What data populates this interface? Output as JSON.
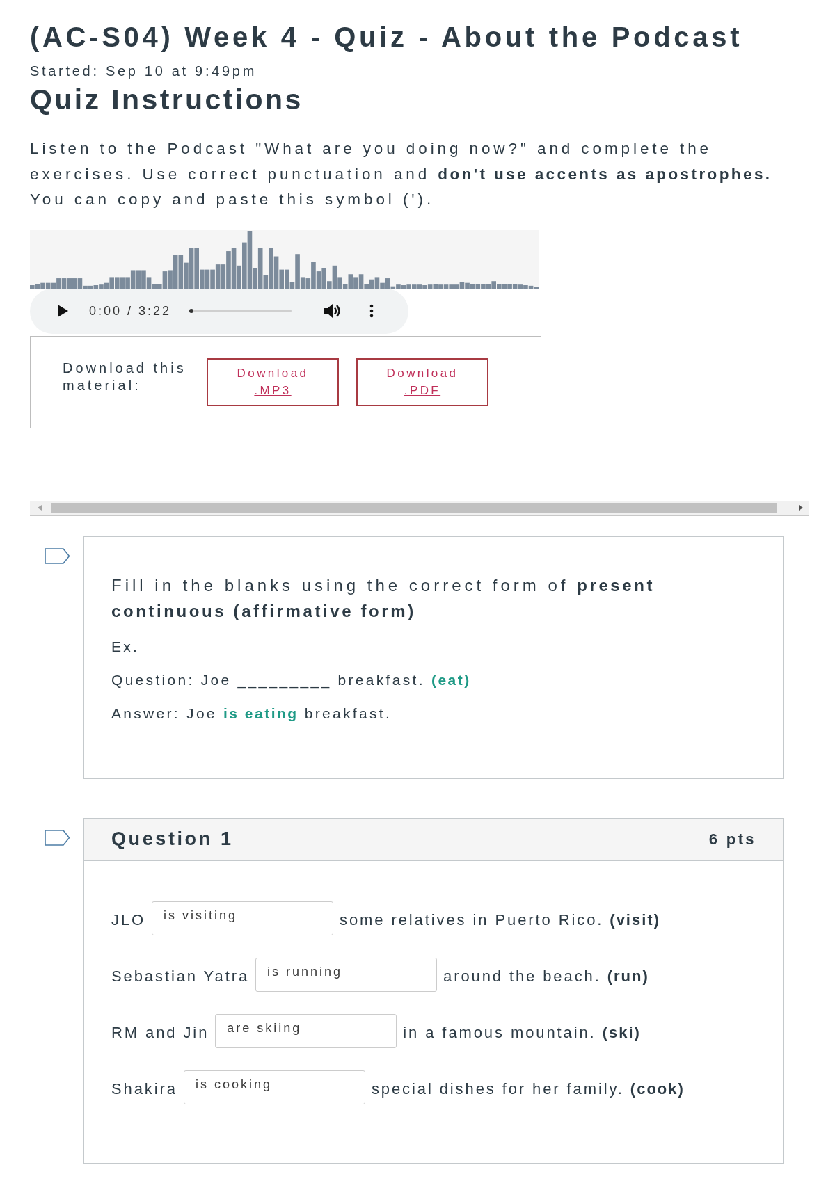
{
  "quiz": {
    "title": "(AC-S04) Week 4 - Quiz - About the Podcast",
    "started": "Started: Sep 10 at 9:49pm"
  },
  "instructions": {
    "heading": "Quiz Instructions",
    "text": "Listen to the Podcast \"What are you doing now?\" and complete the exercises. Use correct punctuation and **don't use accents as apostrophes.** You can copy and paste this symbol (')."
  },
  "audio_player": {
    "time": "0:00 / 3:22",
    "level": 0
  },
  "download": {
    "label": "Download this material:",
    "links": [
      "Download .MP3",
      "Download .PDF"
    ]
  },
  "intro_card": {
    "text": "Fill in the blanks using the correct form of **present continuous (affirmative form)**",
    "lines": [
      "Ex.",
      "Question: Joe _________ breakfast. **(eat)**",
      "Answer: Joe **is eating** breakfast."
    ]
  },
  "question": {
    "title": "Question 1",
    "points": "6 pts",
    "items": [
      {
        "subject": "JLO",
        "answer": "is visiting",
        "rest": "some relatives in Puerto Rico. **(visit)**"
      },
      {
        "subject": "Sebastian Yatra",
        "answer": "is running",
        "rest": "around the beach. **(run)**"
      },
      {
        "subject": "RM and Jin",
        "answer": "are skiing",
        "rest": "in a famous mountain. **(ski)**"
      },
      {
        "subject": "Shakira",
        "answer": "is cooking",
        "rest": "special dishes for her family. **(cook)**"
      }
    ]
  }
}
